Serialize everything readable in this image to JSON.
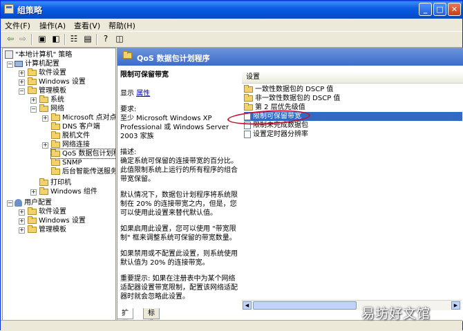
{
  "window": {
    "title": "组策略"
  },
  "menu": [
    "文件(F)",
    "操作(A)",
    "查看(V)",
    "帮助(H)"
  ],
  "tree": {
    "root": "\"本地计算机\" 策略",
    "computer": "计算机配置",
    "computer_children": [
      "软件设置",
      "Windows 设置",
      "管理模板"
    ],
    "admin_children": [
      "系统",
      "网络"
    ],
    "network_children": [
      "Microsoft 点对点",
      "DNS 客户端",
      "脱机文件",
      "网络连接",
      "QoS 数据包计划程",
      "SNMP",
      "后台智能传送服务"
    ],
    "admin_more": [
      "打印机",
      "Windows 组件"
    ],
    "user": "用户配置",
    "user_children": [
      "软件设置",
      "Windows 设置",
      "管理模板"
    ]
  },
  "right": {
    "header": "QoS 数据包计划程序",
    "desc_title": "限制可保留带宽",
    "show_label": "显示",
    "properties_link": "属性",
    "requirement": "要求:\n至少 Microsoft Windows XP Professional 或 Windows Server 2003 家族",
    "description": "描述:\n确定系统可保留的连接带宽的百分比。此值限制系统上运行的所有程序的组合带宽保留。",
    "p2": "默认情况下，数据包计划程序将系统限制在 20% 的连接带宽之内，但是，您可以使用此设置来替代默认值。",
    "p3": "如果启用此设置，您可以使用 \"带宽限制\" 框来调整系统可保留的带宽数量。",
    "p4": "如果禁用或不配置此设置，则系统使用默认值为 20% 的连接带宽。",
    "p5": "重要提示: 如果在注册表中为某个网络适配器设置带宽限制，配置该网络适配器时就会忽略此设置。",
    "list_header": "设置",
    "items": [
      "一致性数据包的 DSCP 值",
      "非一致性数据包的 DSCP 值",
      "第 2 层优先级值",
      "限制可保留带宽",
      "限制未完成数据包",
      "设置定时器分辨率"
    ]
  },
  "tabs": [
    "扩展",
    "标准"
  ],
  "watermark": "易坊好文馆"
}
